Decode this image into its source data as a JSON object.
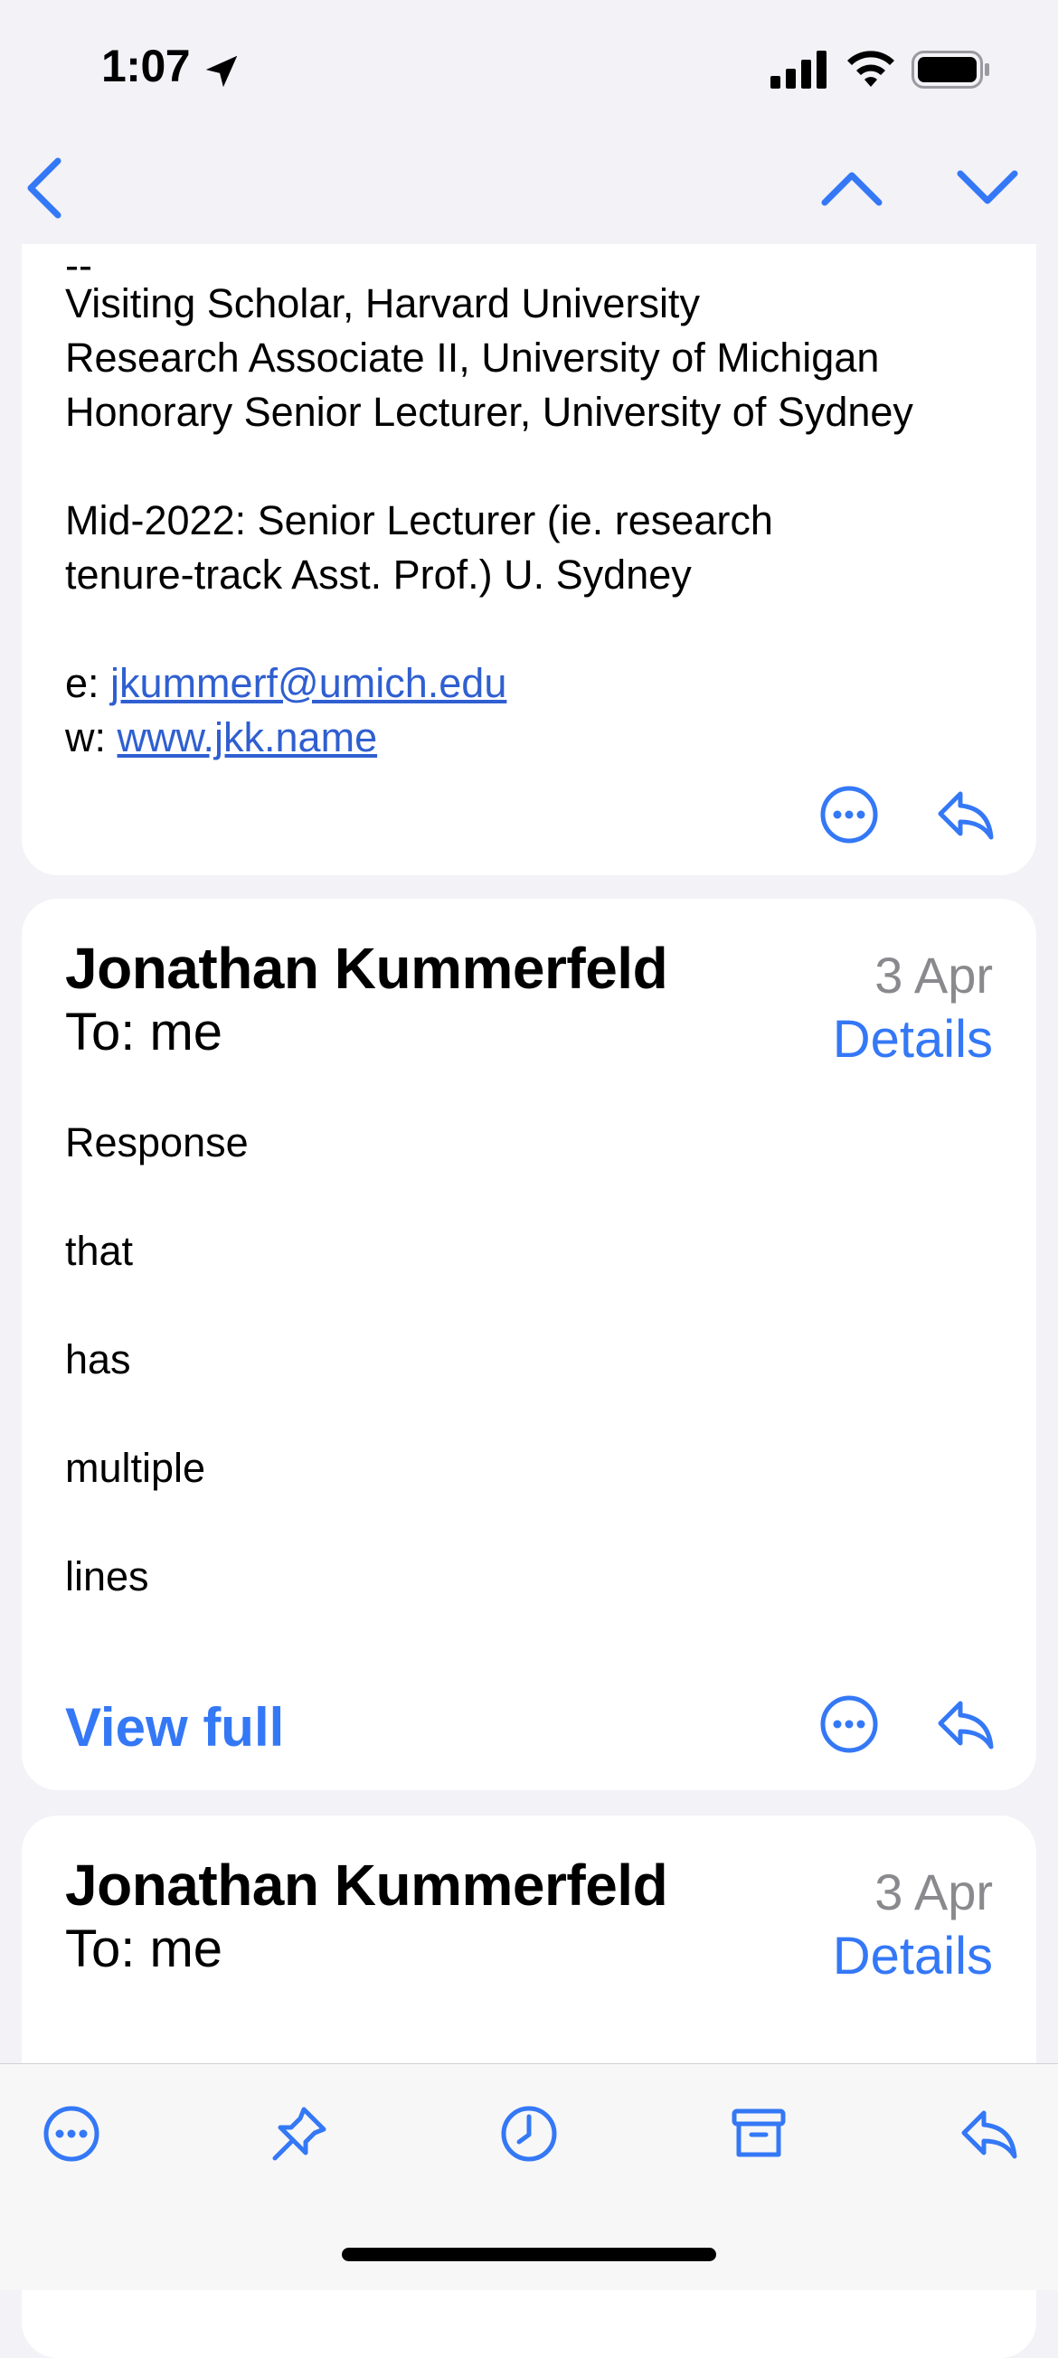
{
  "status": {
    "time": "1:07"
  },
  "signature": {
    "dashes": "--",
    "lines": [
      "Visiting Scholar, Harvard University",
      "Research Associate II, University of Michigan",
      "Honorary Senior Lecturer, University of Sydney"
    ],
    "note_lines": [
      "Mid-2022: Senior Lecturer (ie. research",
      "tenure-track Asst. Prof.) U. Sydney"
    ],
    "email_prefix": "e: ",
    "email": "jkummerf@umich.edu",
    "web_prefix": "w: ",
    "web": "www.jkk.name"
  },
  "messages": [
    {
      "sender": "Jonathan Kummerfeld",
      "date": "3 Apr",
      "to": "To: me",
      "details_label": "Details",
      "body": [
        "Response",
        "that",
        "has",
        "multiple",
        "lines"
      ],
      "view_full_label": "View full"
    },
    {
      "sender": "Jonathan Kummerfeld",
      "date": "3 Apr",
      "to": "To: me",
      "details_label": "Details"
    }
  ],
  "colors": {
    "accent": "#3478f6",
    "link": "#2f5fd0",
    "background": "#f2f2f7",
    "secondary_text": "#8a8a8e"
  }
}
